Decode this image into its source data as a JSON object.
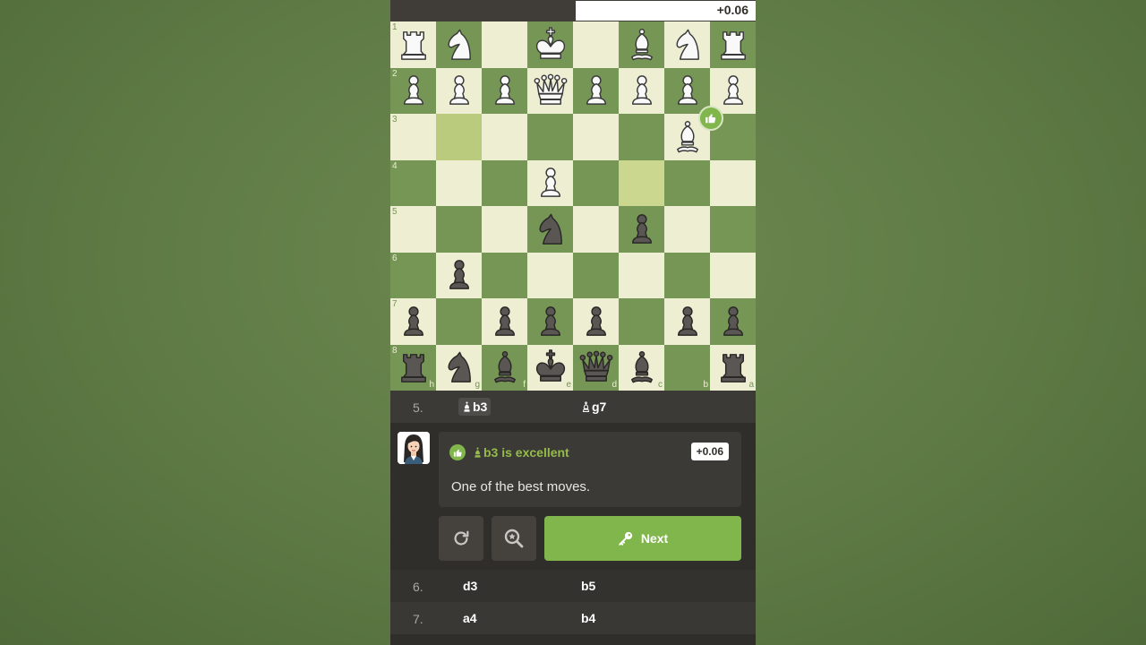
{
  "eval_bar": {
    "score": "+0.06",
    "white_fraction": 0.5
  },
  "board": {
    "orientation": "black-bottom",
    "ranks": [
      "1",
      "2",
      "3",
      "4",
      "5",
      "6",
      "7",
      "8"
    ],
    "files": [
      "h",
      "g",
      "f",
      "e",
      "d",
      "c",
      "b",
      "a"
    ],
    "highlight_squares": [
      "g3",
      "c4"
    ],
    "pieces": [
      [
        "wR",
        "wN",
        "",
        "wK",
        "",
        "wB",
        "wN",
        "wR"
      ],
      [
        "wP",
        "wP",
        "wP",
        "wQ",
        "wP",
        "wP",
        "wP",
        "wP"
      ],
      [
        "",
        "",
        "",
        "",
        "",
        "",
        "wB",
        ""
      ],
      [
        "",
        "",
        "",
        "wP",
        "",
        "",
        "",
        ""
      ],
      [
        "",
        "",
        "",
        "bN",
        "",
        "bP",
        "",
        ""
      ],
      [
        "",
        "bP",
        "",
        "",
        "",
        "",
        "",
        ""
      ],
      [
        "bP",
        "",
        "bP",
        "bP",
        "bP",
        "",
        "bP",
        "bP"
      ],
      [
        "bR",
        "bN",
        "bB",
        "bK",
        "bQ",
        "bB",
        "",
        "bR"
      ]
    ]
  },
  "current_move": {
    "number": "5.",
    "white": "b3",
    "black": "g7"
  },
  "feedback": {
    "title": "b3 is excellent",
    "eval": "+0.06",
    "message": "One of the best moves."
  },
  "actions": {
    "next_label": "Next"
  },
  "move_list": [
    {
      "number": "6.",
      "white": "d3",
      "black": "b5"
    },
    {
      "number": "7.",
      "white": "a4",
      "black": "b4"
    }
  ],
  "colors": {
    "light_square": "#eeeed2",
    "dark_square": "#769656",
    "accent": "#81b64c"
  }
}
